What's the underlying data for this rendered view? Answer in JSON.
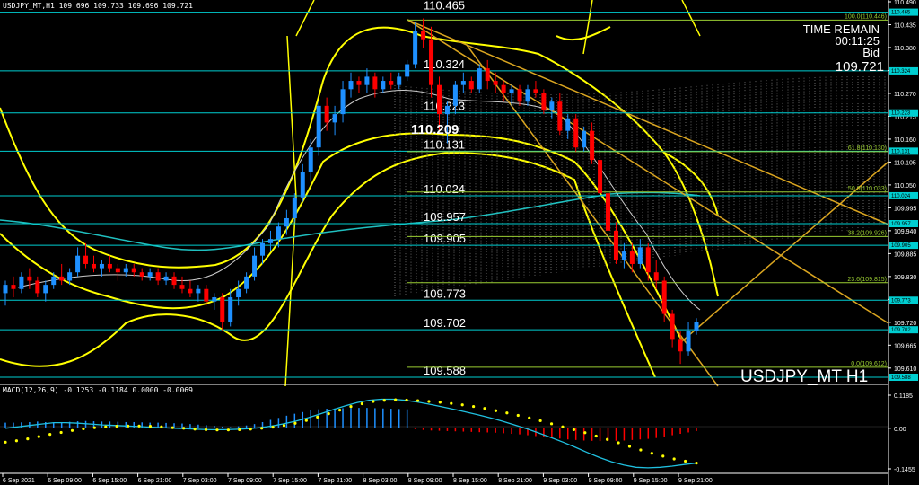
{
  "header": {
    "symbol_info": "USDJPY_MT,H1  109.696 109.733 109.696 109.721",
    "macd_info": "MACD(12,26,9) -0.1253 -0.1184 0.0000 -0.0069"
  },
  "overlay": {
    "time_remain_label": "TIME REMAIN",
    "time_remain_value": "00:11:25",
    "bid_label": "Bid",
    "bid_value": "109.721",
    "watermark": "USDJPY_MT H1",
    "center_price": "110.209"
  },
  "colors": {
    "background": "#000000",
    "bull": "#1e90ff",
    "bear": "#ff0000",
    "bands": "#ffff00",
    "levels": "#00ced1",
    "fib": "#9acd32",
    "trend": "#daa520",
    "ma": "#20c0c0",
    "signal": "#ffff00",
    "macd_line": "#20c0e0"
  },
  "chart_data": [
    {
      "type": "candlestick",
      "title": "USDJPY_MT,H1",
      "ylim": [
        109.588,
        110.49
      ],
      "y_ticks": [
        "110.490",
        "110.435",
        "110.380",
        "110.325",
        "110.270",
        "110.215",
        "110.160",
        "110.105",
        "110.050",
        "109.995",
        "109.940",
        "109.885",
        "109.830",
        "109.775",
        "109.720",
        "109.665",
        "109.610"
      ],
      "x_ticks": [
        "6 Sep 2021",
        "6 Sep 09:00",
        "6 Sep 15:00",
        "6 Sep 21:00",
        "7 Sep 03:00",
        "7 Sep 09:00",
        "7 Sep 15:00",
        "7 Sep 21:00",
        "8 Sep 03:00",
        "8 Sep 09:00",
        "8 Sep 15:00",
        "8 Sep 21:00",
        "9 Sep 03:00",
        "9 Sep 09:00",
        "9 Sep 15:00",
        "9 Sep 21:00"
      ],
      "horizontal_levels": [
        {
          "label": "110.465",
          "value": 110.465
        },
        {
          "label": "110.324",
          "value": 110.324
        },
        {
          "label": "110.223",
          "value": 110.223
        },
        {
          "label": "110.131",
          "value": 110.131
        },
        {
          "label": "110.024",
          "value": 110.024
        },
        {
          "label": "109.957",
          "value": 109.957
        },
        {
          "label": "109.905",
          "value": 109.905
        },
        {
          "label": "109.773",
          "value": 109.773
        },
        {
          "label": "109.702",
          "value": 109.702
        },
        {
          "label": "109.588",
          "value": 109.588
        }
      ],
      "fib_levels": [
        {
          "label": "100.0(110.446)",
          "value": 110.446
        },
        {
          "label": "61.8(110.130)",
          "value": 110.13
        },
        {
          "label": "50.0(110.033)",
          "value": 110.033
        },
        {
          "label": "38.2(109.926)",
          "value": 109.926
        },
        {
          "label": "23.6(109.815)",
          "value": 109.815
        },
        {
          "label": "0.0(109.612)",
          "value": 109.612
        }
      ],
      "candles": [
        [
          109.79,
          109.82,
          109.76,
          109.81
        ],
        [
          109.81,
          109.83,
          109.78,
          109.8
        ],
        [
          109.8,
          109.84,
          109.79,
          109.83
        ],
        [
          109.83,
          109.85,
          109.8,
          109.82
        ],
        [
          109.82,
          109.83,
          109.78,
          109.79
        ],
        [
          109.79,
          109.82,
          109.77,
          109.81
        ],
        [
          109.81,
          109.84,
          109.8,
          109.83
        ],
        [
          109.83,
          109.86,
          109.81,
          109.82
        ],
        [
          109.82,
          109.85,
          109.81,
          109.84
        ],
        [
          109.84,
          109.9,
          109.83,
          109.88
        ],
        [
          109.88,
          109.91,
          109.85,
          109.86
        ],
        [
          109.86,
          109.88,
          109.84,
          109.85
        ],
        [
          109.85,
          109.87,
          109.83,
          109.86
        ],
        [
          109.86,
          109.88,
          109.84,
          109.85
        ],
        [
          109.85,
          109.86,
          109.82,
          109.84
        ],
        [
          109.84,
          109.86,
          109.83,
          109.85
        ],
        [
          109.85,
          109.86,
          109.83,
          109.84
        ],
        [
          109.84,
          109.85,
          109.82,
          109.83
        ],
        [
          109.83,
          109.85,
          109.82,
          109.84
        ],
        [
          109.84,
          109.85,
          109.81,
          109.82
        ],
        [
          109.82,
          109.84,
          109.81,
          109.83
        ],
        [
          109.83,
          109.84,
          109.8,
          109.81
        ],
        [
          109.81,
          109.83,
          109.79,
          109.8
        ],
        [
          109.8,
          109.82,
          109.78,
          109.79
        ],
        [
          109.79,
          109.81,
          109.77,
          109.8
        ],
        [
          109.8,
          109.81,
          109.76,
          109.77
        ],
        [
          109.77,
          109.79,
          109.75,
          109.78
        ],
        [
          109.78,
          109.79,
          109.7,
          109.72
        ],
        [
          109.72,
          109.8,
          109.71,
          109.78
        ],
        [
          109.78,
          109.82,
          109.76,
          109.8
        ],
        [
          109.8,
          109.84,
          109.79,
          109.83
        ],
        [
          109.83,
          109.9,
          109.82,
          109.88
        ],
        [
          109.88,
          109.92,
          109.86,
          109.91
        ],
        [
          109.91,
          109.94,
          109.89,
          109.92
        ],
        [
          109.92,
          109.96,
          109.9,
          109.95
        ],
        [
          109.95,
          109.99,
          109.93,
          109.97
        ],
        [
          109.97,
          110.03,
          109.96,
          110.02
        ],
        [
          110.02,
          110.1,
          110.01,
          110.08
        ],
        [
          110.08,
          110.16,
          110.06,
          110.14
        ],
        [
          110.14,
          110.25,
          110.12,
          110.24
        ],
        [
          110.24,
          110.26,
          110.18,
          110.2
        ],
        [
          110.2,
          110.24,
          110.17,
          110.22
        ],
        [
          110.22,
          110.3,
          110.2,
          110.28
        ],
        [
          110.28,
          110.32,
          110.26,
          110.3
        ],
        [
          110.3,
          110.31,
          110.27,
          110.29
        ],
        [
          110.29,
          110.33,
          110.27,
          110.31
        ],
        [
          110.31,
          110.32,
          110.26,
          110.28
        ],
        [
          110.28,
          110.31,
          110.27,
          110.3
        ],
        [
          110.3,
          110.32,
          110.28,
          110.29
        ],
        [
          110.29,
          110.32,
          110.28,
          110.31
        ],
        [
          110.31,
          110.35,
          110.3,
          110.34
        ],
        [
          110.34,
          110.44,
          110.33,
          110.42
        ],
        [
          110.42,
          110.45,
          110.38,
          110.4
        ],
        [
          110.4,
          110.43,
          110.26,
          110.29
        ],
        [
          110.29,
          110.31,
          110.18,
          110.22
        ],
        [
          110.22,
          110.25,
          110.15,
          110.24
        ],
        [
          110.24,
          110.3,
          110.22,
          110.29
        ],
        [
          110.29,
          110.32,
          110.27,
          110.3
        ],
        [
          110.3,
          110.31,
          110.27,
          110.28
        ],
        [
          110.28,
          110.34,
          110.27,
          110.33
        ],
        [
          110.33,
          110.35,
          110.28,
          110.3
        ],
        [
          110.3,
          110.32,
          110.27,
          110.29
        ],
        [
          110.29,
          110.3,
          110.25,
          110.27
        ],
        [
          110.27,
          110.29,
          110.24,
          110.28
        ],
        [
          110.28,
          110.29,
          110.24,
          110.25
        ],
        [
          110.25,
          110.29,
          110.24,
          110.28
        ],
        [
          110.28,
          110.3,
          110.26,
          110.27
        ],
        [
          110.27,
          110.28,
          110.22,
          110.23
        ],
        [
          110.23,
          110.26,
          110.21,
          110.25
        ],
        [
          110.25,
          110.27,
          110.17,
          110.18
        ],
        [
          110.18,
          110.22,
          110.16,
          110.21
        ],
        [
          110.21,
          110.22,
          110.13,
          110.14
        ],
        [
          110.14,
          110.19,
          110.13,
          110.18
        ],
        [
          110.18,
          110.2,
          110.1,
          110.11
        ],
        [
          110.11,
          110.12,
          110.02,
          110.03
        ],
        [
          110.03,
          110.04,
          109.93,
          109.94
        ],
        [
          109.94,
          109.96,
          109.86,
          109.87
        ],
        [
          109.87,
          109.91,
          109.85,
          109.89
        ],
        [
          109.89,
          109.91,
          109.84,
          109.86
        ],
        [
          109.86,
          109.92,
          109.85,
          109.9
        ],
        [
          109.9,
          109.91,
          109.82,
          109.84
        ],
        [
          109.84,
          109.87,
          109.8,
          109.82
        ],
        [
          109.82,
          109.83,
          109.72,
          109.74
        ],
        [
          109.74,
          109.75,
          109.66,
          109.68
        ],
        [
          109.68,
          109.7,
          109.62,
          109.65
        ],
        [
          109.65,
          109.72,
          109.64,
          109.7
        ],
        [
          109.7,
          109.73,
          109.69,
          109.72
        ]
      ]
    },
    {
      "type": "bar",
      "title": "MACD(12,26,9)",
      "ylim": [
        -0.1455,
        0.1185
      ],
      "y_ticks": [
        "0.1185",
        "0.00",
        "-0.1455"
      ],
      "histogram": [
        0.02,
        0.02,
        0.021,
        0.022,
        0.024,
        0.022,
        0.021,
        0.022,
        0.023,
        0.025,
        0.026,
        0.025,
        0.024,
        0.024,
        0.023,
        0.022,
        0.022,
        0.021,
        0.02,
        0.02,
        0.019,
        0.018,
        0.017,
        0.015,
        0.013,
        0.011,
        0.009,
        0.006,
        0.004,
        0.007,
        0.01,
        0.015,
        0.022,
        0.03,
        0.037,
        0.045,
        0.052,
        0.058,
        0.064,
        0.068,
        0.07,
        0.071,
        0.072,
        0.073,
        0.073,
        0.073,
        0.072,
        0.071,
        0.07,
        0.069,
        0.068,
        -0.003,
        -0.006,
        -0.008,
        -0.009,
        -0.01,
        -0.011,
        -0.012,
        -0.013,
        -0.014,
        -0.015,
        -0.016,
        -0.018,
        -0.02,
        -0.022,
        -0.025,
        -0.028,
        -0.031,
        -0.034,
        -0.037,
        -0.04,
        -0.042,
        -0.044,
        -0.045,
        -0.046,
        -0.046,
        -0.045,
        -0.044,
        -0.042,
        -0.04,
        -0.038,
        -0.035,
        -0.03,
        -0.025,
        -0.02,
        -0.015,
        -0.01
      ],
      "signal": [
        -0.05,
        -0.045,
        -0.038,
        -0.03,
        -0.022,
        -0.015,
        -0.008,
        -0.002,
        0.002,
        0.005,
        0.007,
        0.008,
        0.008,
        0.007,
        0.005,
        0.002,
        0.0,
        -0.003,
        -0.005,
        -0.006,
        -0.006,
        -0.005,
        -0.003,
        0.0,
        0.004,
        0.01,
        0.018,
        0.028,
        0.04,
        0.052,
        0.065,
        0.078,
        0.088,
        0.096,
        0.1,
        0.102,
        0.101,
        0.099,
        0.096,
        0.093,
        0.089,
        0.084,
        0.078,
        0.071,
        0.063,
        0.055,
        0.046,
        0.037,
        0.027,
        0.016,
        0.005,
        -0.005,
        -0.016,
        -0.028,
        -0.04,
        -0.052,
        -0.065,
        -0.078,
        -0.09,
        -0.1,
        -0.11,
        -0.118,
        -0.125
      ],
      "macd": [
        0.0,
        0.005,
        0.01,
        0.015,
        0.02,
        0.02,
        0.018,
        0.015,
        0.012,
        0.01,
        0.008,
        0.006,
        0.004,
        0.002,
        0.0,
        -0.002,
        -0.004,
        -0.005,
        -0.005,
        -0.004,
        -0.002,
        0.002,
        0.008,
        0.016,
        0.026,
        0.038,
        0.052,
        0.066,
        0.08,
        0.092,
        0.1,
        0.104,
        0.104,
        0.1,
        0.094,
        0.086,
        0.077,
        0.068,
        0.058,
        0.048,
        0.037,
        0.025,
        0.012,
        -0.002,
        -0.017,
        -0.033,
        -0.05,
        -0.068,
        -0.087,
        -0.105,
        -0.12,
        -0.132,
        -0.14,
        -0.142,
        -0.14,
        -0.136,
        -0.13,
        -0.125
      ]
    }
  ]
}
